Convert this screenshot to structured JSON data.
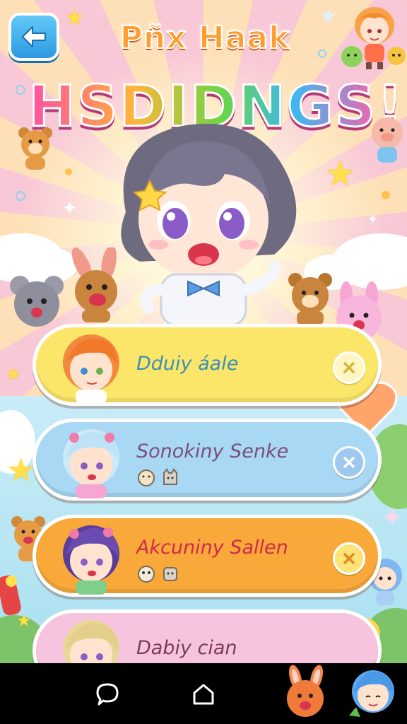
{
  "header": {
    "back_icon": "arrow-left-icon",
    "title_line1": "Pñx Haak",
    "title_line2": "HSDIDNGS!"
  },
  "contacts": [
    {
      "name": "Dduiy áale",
      "color": "#fbe66a",
      "text_color": "#3d8fb4",
      "button_color": "#fff6c4",
      "x_color": "#d5b53a"
    },
    {
      "name": "Sonokiny Senke",
      "color": "#a8d8f4",
      "text_color": "#7b4f7c",
      "button_color": "#9fc8ee",
      "x_color": "#ffffff"
    },
    {
      "name": "Akcuniny Sallen",
      "color": "#f8a93a",
      "text_color": "#d2294d",
      "button_color": "#fde37a",
      "x_color": "#e08a1f"
    },
    {
      "name": "Dabiy cian",
      "color": "#f6c4de",
      "text_color": "#7a3c56",
      "button_color": "#f2a6c8",
      "x_color": "#ffffff"
    }
  ],
  "nav": {
    "items": [
      "chat-bubble-icon",
      "home-icon",
      "bunny-mascot-icon",
      "blue-hair-avatar-icon"
    ]
  },
  "colors": {
    "accent_blue": "#2b9ae0",
    "nav_background": "#000000"
  }
}
